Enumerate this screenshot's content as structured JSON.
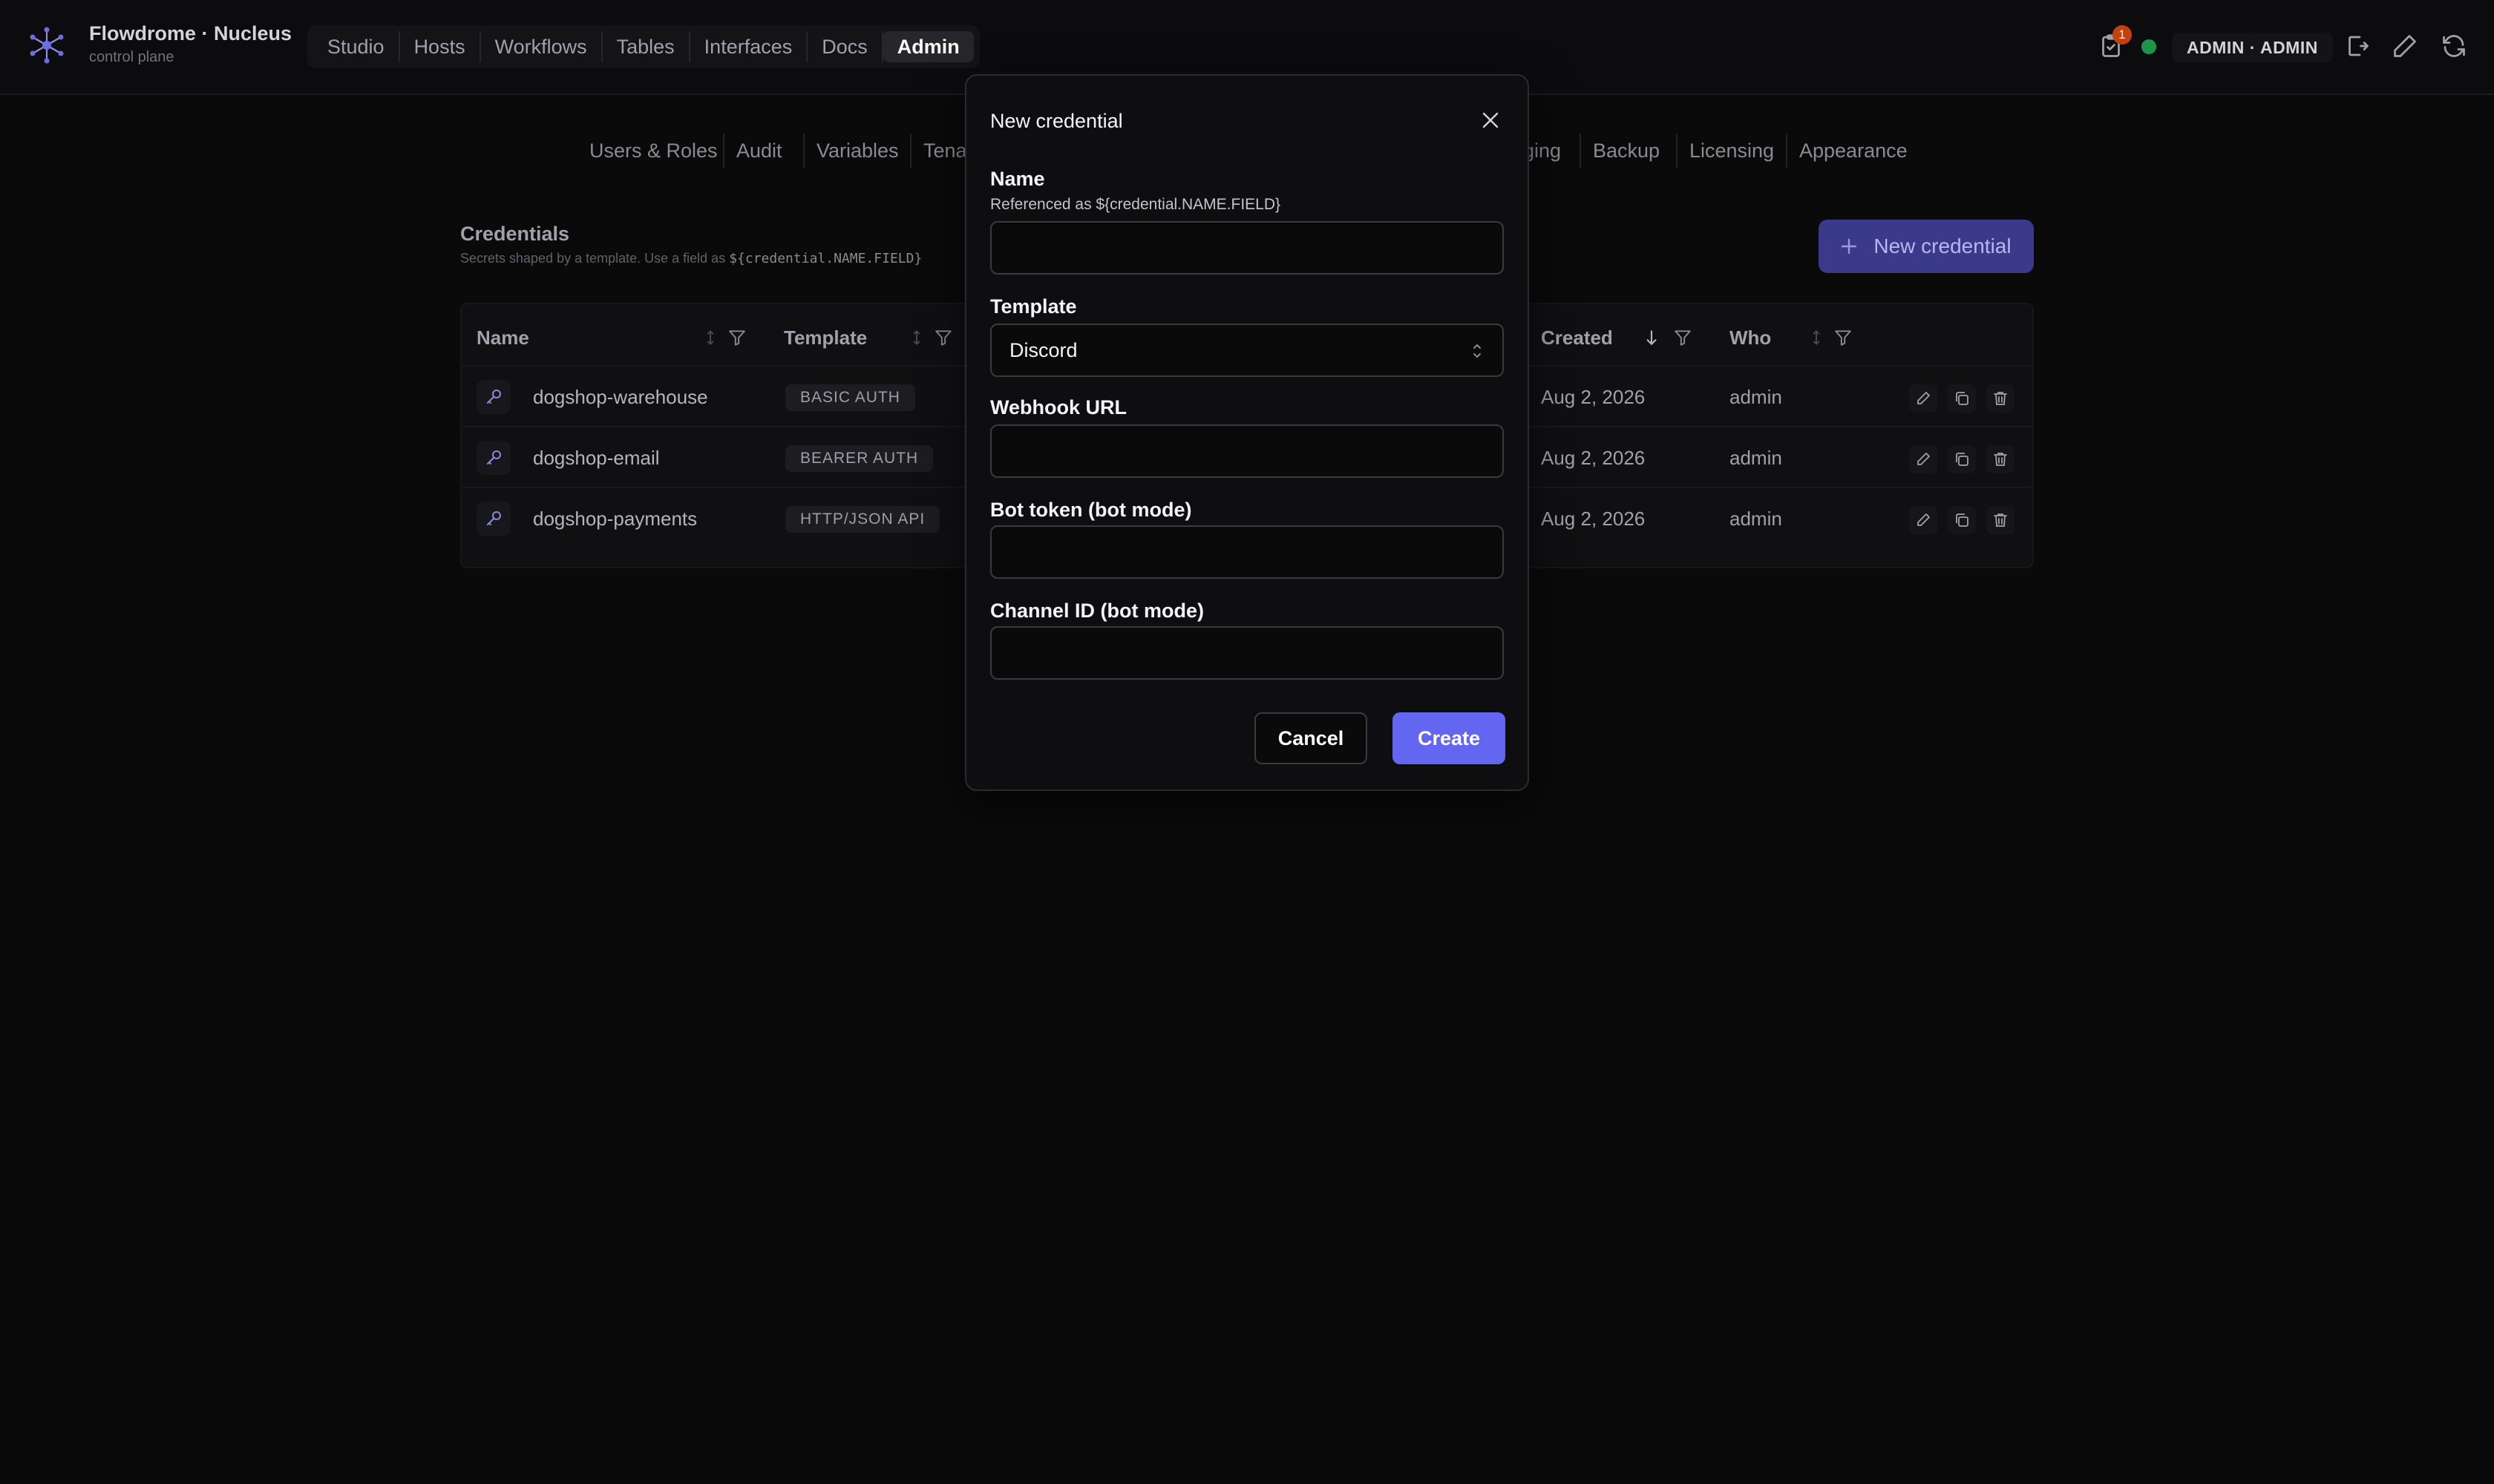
{
  "brand": {
    "name": "Flowdrome · Nucleus",
    "subtitle": "control plane"
  },
  "main_nav": [
    {
      "label": "Studio"
    },
    {
      "label": "Hosts"
    },
    {
      "label": "Workflows"
    },
    {
      "label": "Tables"
    },
    {
      "label": "Interfaces"
    },
    {
      "label": "Docs"
    },
    {
      "label": "Admin",
      "active": true
    }
  ],
  "topbar": {
    "notification_count": "1",
    "user_label": "ADMIN · ADMIN",
    "status_color": "#22c55e"
  },
  "admin_nav": [
    {
      "label": "Users & Roles"
    },
    {
      "label": "Audit"
    },
    {
      "label": "Variables"
    },
    {
      "label": "Tena"
    },
    {
      "label": "ging"
    },
    {
      "label": "Backup"
    },
    {
      "label": "Licensing"
    },
    {
      "label": "Appearance"
    }
  ],
  "credentials": {
    "title": "Credentials",
    "description_prefix": "Secrets shaped by a template. Use a field as ",
    "description_code": "${credential.NAME.FIELD}",
    "new_button": "New credential",
    "columns": {
      "name": "Name",
      "template": "Template",
      "created": "Created",
      "who": "Who"
    },
    "rows": [
      {
        "name": "dogshop-warehouse",
        "template": "BASIC AUTH",
        "created": "Aug 2, 2026",
        "who": "admin"
      },
      {
        "name": "dogshop-email",
        "template": "BEARER AUTH",
        "created": "Aug 2, 2026",
        "who": "admin"
      },
      {
        "name": "dogshop-payments",
        "template": "HTTP/JSON API",
        "created": "Aug 2, 2026",
        "who": "admin"
      }
    ]
  },
  "modal": {
    "title": "New credential",
    "name_label": "Name",
    "name_hint": "Referenced as ${credential.NAME.FIELD}",
    "name_value": "",
    "template_label": "Template",
    "template_value": "Discord",
    "webhook_label": "Webhook URL",
    "webhook_value": "",
    "bot_token_label": "Bot token (bot mode)",
    "bot_token_value": "",
    "channel_label": "Channel ID (bot mode)",
    "channel_value": "",
    "cancel_label": "Cancel",
    "create_label": "Create"
  },
  "icons": {
    "logo": "asterisk-network-logo-icon",
    "notifications": "clipboard-check-icon",
    "logout": "log-out-icon",
    "edit": "pencil-icon",
    "refresh": "refresh-icon",
    "sort": "sort-icon",
    "filter": "filter-icon",
    "key": "key-icon",
    "copy": "copy-icon",
    "delete": "trash-icon",
    "close": "close-icon",
    "plus": "plus-icon",
    "chevron": "chevron-up-down-icon"
  },
  "colors": {
    "accent": "#6366f1",
    "accent_dim": "#3b3a8a",
    "background": "#0a0a0b",
    "badge": "#c2410c"
  }
}
